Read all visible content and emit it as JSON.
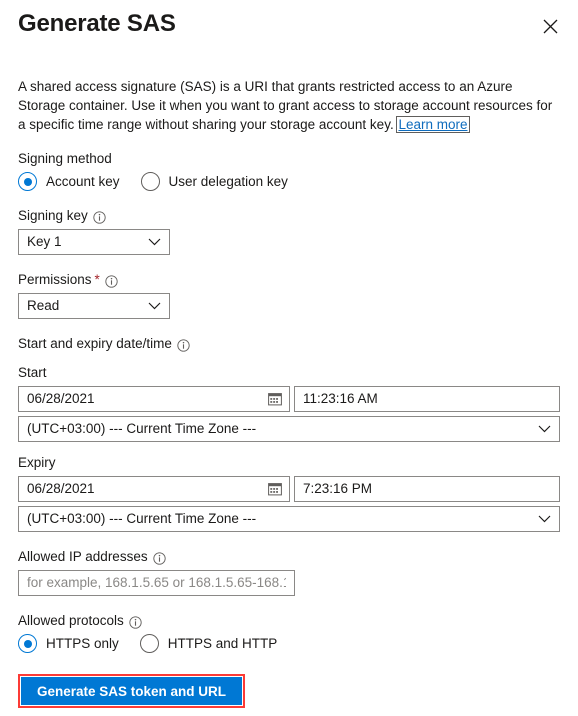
{
  "header": {
    "title": "Generate SAS",
    "close_label": "Close",
    "close_icon": "close-icon"
  },
  "description": {
    "text_before_link": "A shared access signature (SAS) is a URI that grants restricted access to an Azure Storage container. Use it when you want to grant access to storage account resources for a specific time range without sharing your storage account key. ",
    "link_label": "Learn more"
  },
  "signing_method": {
    "label": "Signing method",
    "options": [
      {
        "label": "Account key",
        "checked": true
      },
      {
        "label": "User delegation key",
        "checked": false
      }
    ]
  },
  "signing_key": {
    "label": "Signing key",
    "info_icon": "info-icon",
    "value": "Key 1",
    "chevron_icon": "chevron-down-icon"
  },
  "permissions": {
    "label": "Permissions",
    "required_marker": "*",
    "info_icon": "info-icon",
    "value": "Read",
    "chevron_icon": "chevron-down-icon"
  },
  "date_time": {
    "section_label": "Start and expiry date/time",
    "info_icon": "info-icon",
    "start": {
      "label": "Start",
      "date": "06/28/2021",
      "time": "11:23:16 AM",
      "timezone": "(UTC+03:00) --- Current Time Zone ---",
      "calendar_icon": "calendar-icon",
      "chevron_icon": "chevron-down-icon"
    },
    "expiry": {
      "label": "Expiry",
      "date": "06/28/2021",
      "time": "7:23:16 PM",
      "timezone": "(UTC+03:00) --- Current Time Zone ---",
      "calendar_icon": "calendar-icon",
      "chevron_icon": "chevron-down-icon"
    }
  },
  "allowed_ip": {
    "label": "Allowed IP addresses",
    "info_icon": "info-icon",
    "value": "",
    "placeholder": "for example, 168.1.5.65 or 168.1.5.65-168.1...."
  },
  "allowed_protocols": {
    "label": "Allowed protocols",
    "info_icon": "info-icon",
    "options": [
      {
        "label": "HTTPS only",
        "checked": true
      },
      {
        "label": "HTTPS and HTTP",
        "checked": false
      }
    ]
  },
  "actions": {
    "generate_label": "Generate SAS token and URL"
  },
  "colors": {
    "accent": "#0078d4",
    "link": "#0f6cbd",
    "required": "#a4262c",
    "highlight": "#fc3b36",
    "border": "#8a8886",
    "text": "#1b1a19",
    "placeholder": "#8a8886"
  }
}
